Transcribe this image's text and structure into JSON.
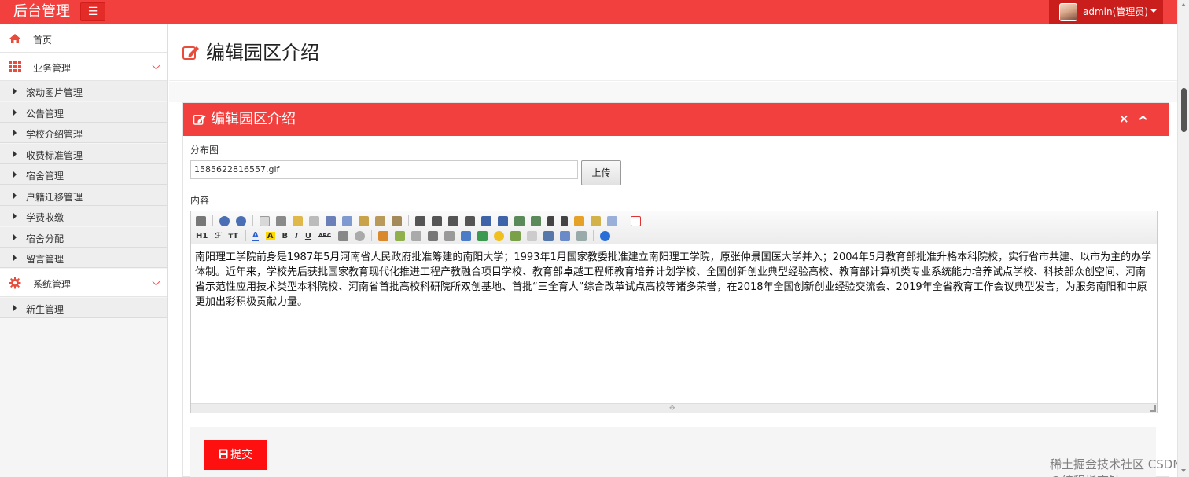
{
  "topbar": {
    "brand": "后台管理",
    "menu_icon": "☰",
    "user_label": "admin(管理员)"
  },
  "sidebar": {
    "home": "首页",
    "groups": [
      {
        "label": "业务管理",
        "items": [
          "滚动图片管理",
          "公告管理",
          "学校介绍管理",
          "收费标准管理",
          "宿舍管理",
          "户籍迁移管理",
          "学费收缴",
          "宿舍分配",
          "留言管理"
        ]
      },
      {
        "label": "系统管理",
        "items": [
          "新生管理"
        ]
      }
    ]
  },
  "page": {
    "title": "编辑园区介绍"
  },
  "panel": {
    "title": "编辑园区介绍",
    "close_glyph": "×"
  },
  "form": {
    "map_label": "分布图",
    "map_value": "1585622816557.gif",
    "upload_label": "上传",
    "content_label": "内容",
    "content_text": "南阳理工学院前身是1987年5月河南省人民政府批准筹建的南阳大学；1993年1月国家教委批准建立南阳理工学院，原张仲景国医大学并入；2004年5月教育部批准升格本科院校，实行省市共建、以市为主的办学体制。近年来，学校先后获批国家教育现代化推进工程产教融合项目学校、教育部卓越工程师教育培养计划学校、全国创新创业典型经验高校、教育部计算机类专业系统能力培养试点学校、科技部众创空间、河南省示范性应用技术类型本科院校、河南省首批高校科研院所双创基地、首批“三全育人”综合改革试点高校等诸多荣誉，在2018年全国创新创业经验交流会、2019年全省教育工作会议典型发言，为服务南阳和中原更加出彩积极贡献力量。",
    "submit_label": "提交"
  },
  "editor_toolbar": {
    "heading": "H1",
    "font": "ℱ",
    "size": "тT",
    "font_color": "A",
    "bg_color": "A",
    "bold": "B",
    "italic": "I",
    "underline": "U",
    "strike": "ABC"
  },
  "watermark": "稀土掘金技术社区 CSDN @编程指南针",
  "colors": {
    "primary": "#f2403e",
    "submit": "#ff1010"
  }
}
